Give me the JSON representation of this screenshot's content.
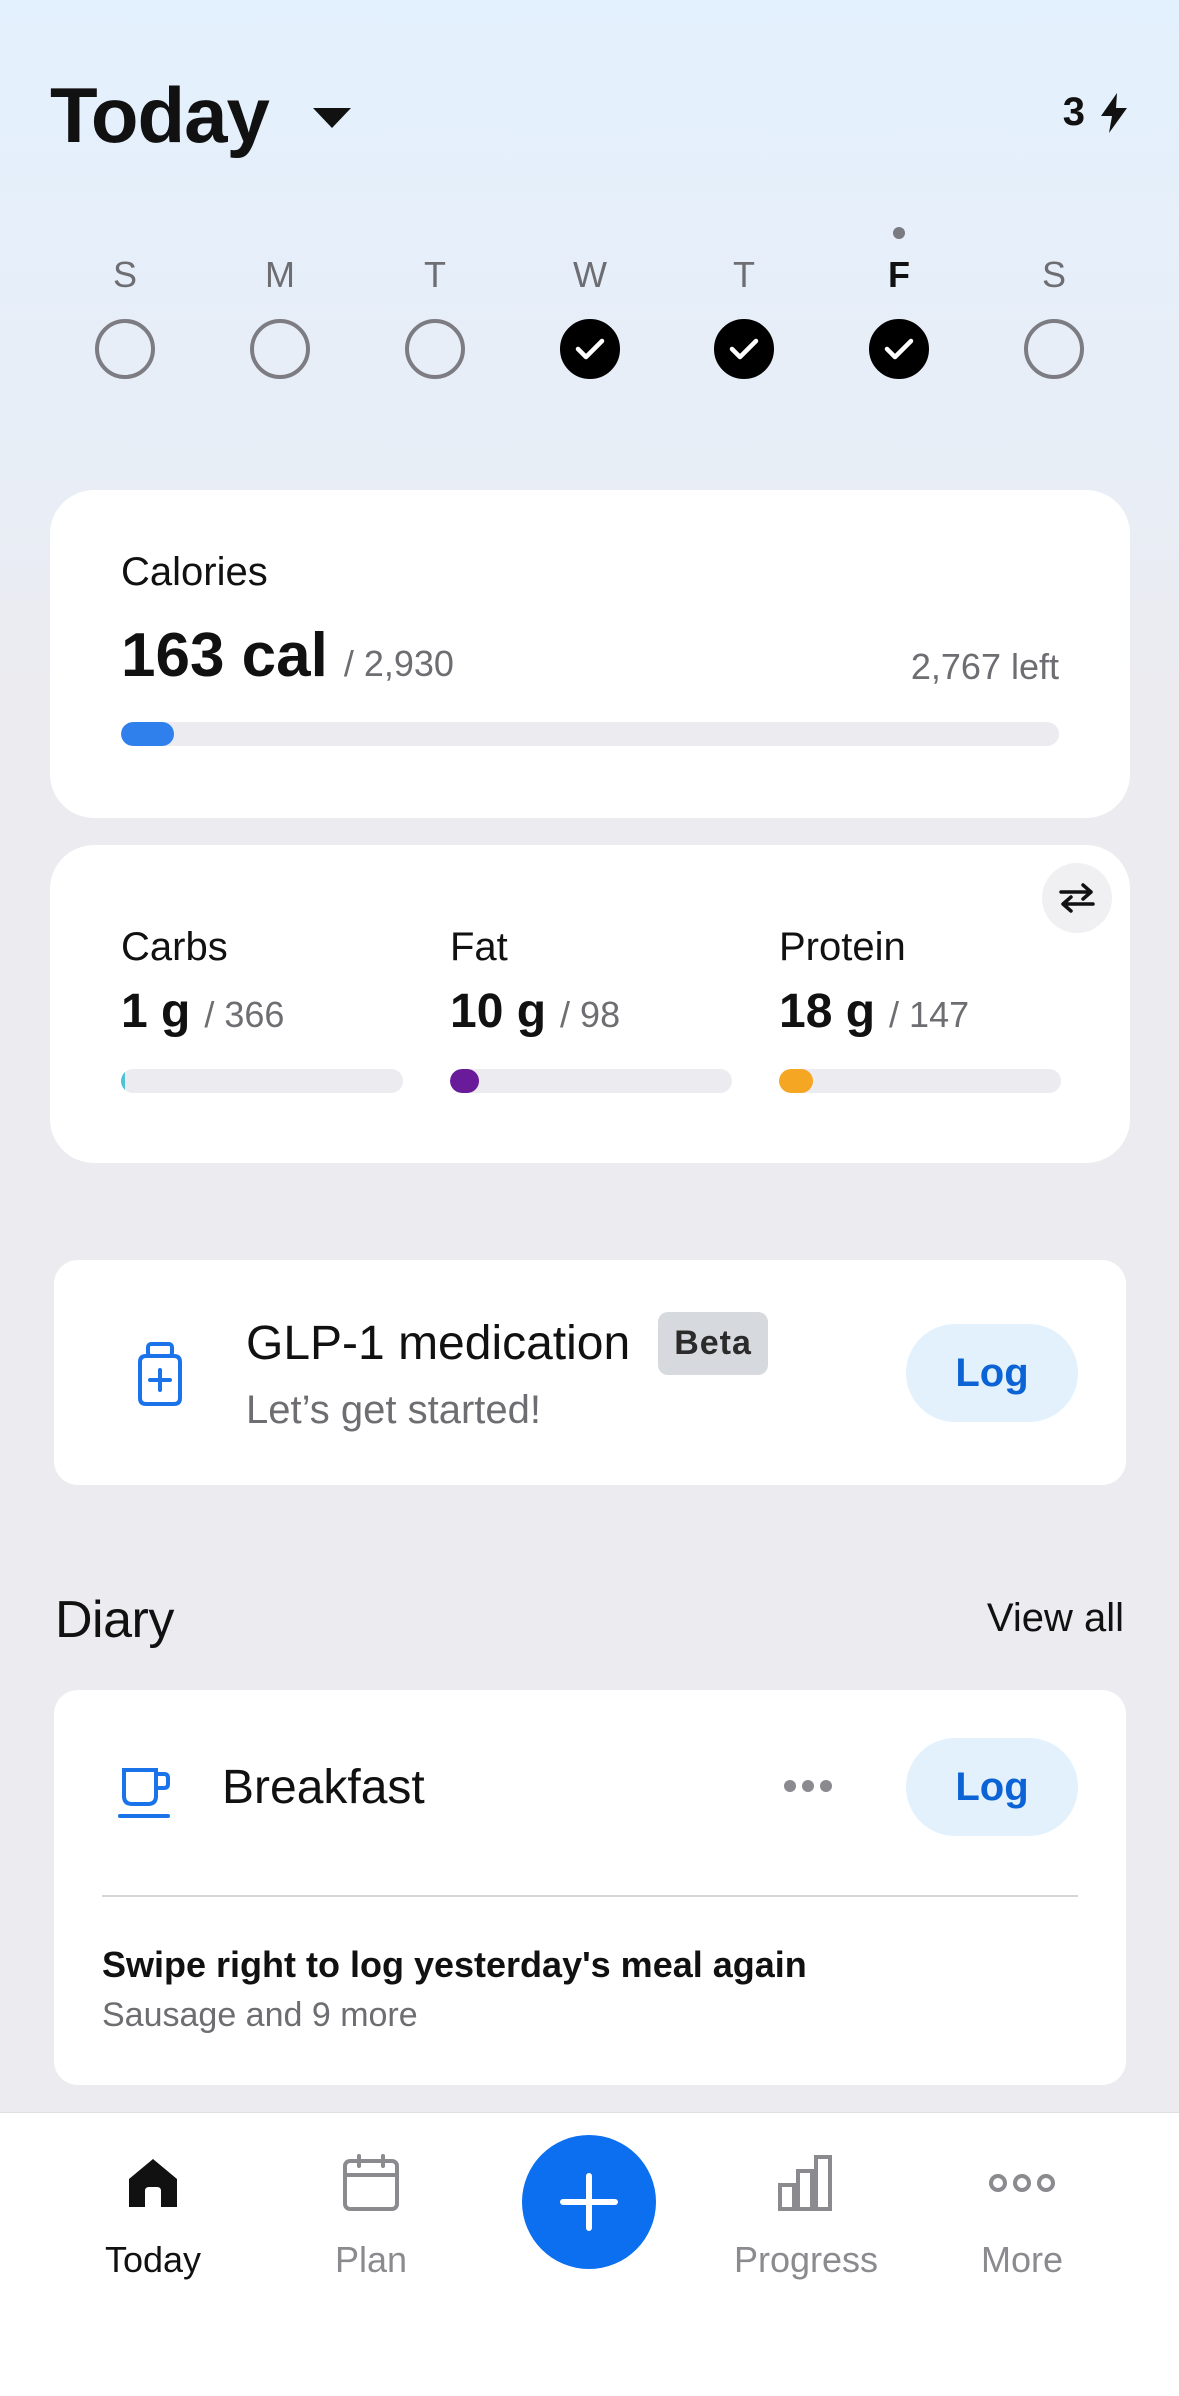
{
  "header": {
    "title": "Today",
    "streak_count": "3"
  },
  "week": [
    {
      "letter": "S",
      "logged": false,
      "today": false
    },
    {
      "letter": "M",
      "logged": false,
      "today": false
    },
    {
      "letter": "T",
      "logged": false,
      "today": false
    },
    {
      "letter": "W",
      "logged": true,
      "today": false
    },
    {
      "letter": "T",
      "logged": true,
      "today": false
    },
    {
      "letter": "F",
      "logged": true,
      "today": true
    },
    {
      "letter": "S",
      "logged": false,
      "today": false
    }
  ],
  "calories": {
    "label": "Calories",
    "consumed": "163 cal",
    "goal": "/ 2,930",
    "left": "2,767 left",
    "progress": 0.056,
    "color": "#2f80ed"
  },
  "macros": [
    {
      "label": "Carbs",
      "value": "1 g",
      "goal": "/ 366",
      "progress": 0.003,
      "color": "#4ec3d8"
    },
    {
      "label": "Fat",
      "value": "10 g",
      "goal": "/ 98",
      "progress": 0.102,
      "color": "#6a1b9a"
    },
    {
      "label": "Protein",
      "value": "18 g",
      "goal": "/ 147",
      "progress": 0.122,
      "color": "#f5a623"
    }
  ],
  "glp": {
    "title": "GLP-1 medication",
    "badge": "Beta",
    "subtitle": "Let’s get started!",
    "log_label": "Log"
  },
  "diary": {
    "title": "Diary",
    "view_all": "View all",
    "breakfast": {
      "title": "Breakfast",
      "log_label": "Log",
      "hint": "Swipe right to log yesterday's meal again",
      "hint_sub": "Sausage and 9 more"
    }
  },
  "tabbar": {
    "today": "Today",
    "plan": "Plan",
    "progress": "Progress",
    "more": "More"
  },
  "colors": {
    "accent": "#0b6ff0",
    "log_button_bg": "#e3f1fc",
    "log_button_text": "#0b63d6"
  }
}
